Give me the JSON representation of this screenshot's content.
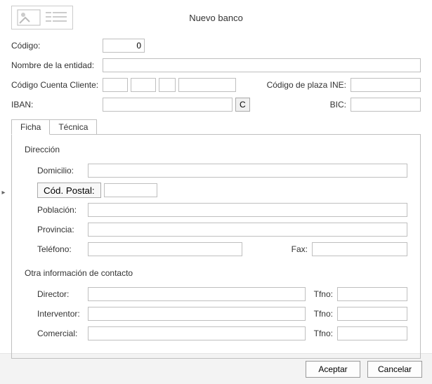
{
  "window": {
    "title": "Nuevo banco"
  },
  "fields": {
    "codigo": {
      "label": "Código:",
      "value": "0"
    },
    "nombre": {
      "label": "Nombre de la entidad:",
      "value": ""
    },
    "ccc": {
      "label": "Código Cuenta Cliente:",
      "a": "",
      "b": "",
      "c": "",
      "d": ""
    },
    "plaza_ine": {
      "label": "Código de plaza INE:",
      "value": ""
    },
    "iban": {
      "label": "IBAN:",
      "value": "",
      "calc_btn": "C"
    },
    "bic": {
      "label": "BIC:",
      "value": ""
    }
  },
  "tabs": {
    "ficha": "Ficha",
    "tecnica": "Técnica"
  },
  "ficha": {
    "direccion_title": "Dirección",
    "domicilio": {
      "label": "Domicilio:",
      "value": ""
    },
    "cod_postal": {
      "button": "Cód. Postal:",
      "value": ""
    },
    "poblacion": {
      "label": "Población:",
      "value": ""
    },
    "provincia": {
      "label": "Provincia:",
      "value": ""
    },
    "telefono": {
      "label": "Teléfono:",
      "value": ""
    },
    "fax": {
      "label": "Fax:",
      "value": ""
    },
    "otra_title": "Otra información de contacto",
    "director": {
      "label": "Director:",
      "value": "",
      "tfno_label": "Tfno:",
      "tfno": ""
    },
    "interventor": {
      "label": "Interventor:",
      "value": "",
      "tfno_label": "Tfno:",
      "tfno": ""
    },
    "comercial": {
      "label": "Comercial:",
      "value": "",
      "tfno_label": "Tfno:",
      "tfno": ""
    }
  },
  "footer": {
    "accept": "Aceptar",
    "cancel": "Cancelar"
  }
}
